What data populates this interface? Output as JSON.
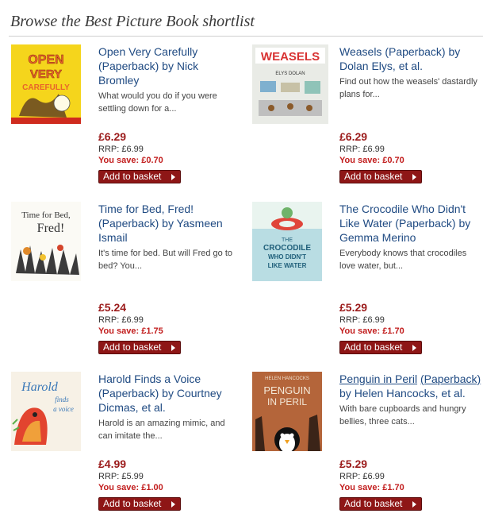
{
  "header": {
    "title": "Browse the Best Picture Book shortlist"
  },
  "labels": {
    "rrp_prefix": "RRP: ",
    "save_prefix": "You save: ",
    "add_button": "Add to basket"
  },
  "products": [
    {
      "title": "Open Very Carefully",
      "format": "(Paperback)",
      "by": "by",
      "author": "Nick Bromley",
      "blurb": "What would you do if you were settling down for a...",
      "price": "£6.29",
      "rrp": "£6.99",
      "save": "£0.70",
      "cover_text": [
        "OPEN",
        "VERY",
        "CAREFULLY"
      ]
    },
    {
      "title": "Weasels",
      "format": "(Paperback)",
      "by": "by",
      "author": "Dolan Elys, et al.",
      "blurb": "Find out how the weasels' dastardly plans for...",
      "price": "£6.29",
      "rrp": "£6.99",
      "save": "£0.70",
      "cover_text": [
        "WEASELS",
        "ELYS DOLAN"
      ]
    },
    {
      "title": "Time for Bed, Fred!",
      "format": "(Paperback)",
      "by": "by",
      "author": "Yasmeen Ismail",
      "blurb": "It's time for bed. But will Fred go to bed? You...",
      "price": "£5.24",
      "rrp": "£6.99",
      "save": "£1.75",
      "cover_text": [
        "Time for Bed,",
        "Fred!"
      ]
    },
    {
      "title": "The Crocodile Who Didn't Like Water",
      "format": "(Paperback)",
      "by": "by",
      "author": "Gemma Merino",
      "blurb": "Everybody knows that crocodiles love water, but...",
      "price": "£5.29",
      "rrp": "£6.99",
      "save": "£1.70",
      "cover_text": [
        "THE",
        "CROCODILE",
        "WHO DIDN'T",
        "LIKE WATER"
      ]
    },
    {
      "title": "Harold Finds a Voice",
      "format": "(Paperback)",
      "by": "by",
      "author": "Courtney Dicmas, et al.",
      "blurb": "Harold is an amazing mimic, and can imitate the...",
      "price": "£4.99",
      "rrp": "£5.99",
      "save": "£1.00",
      "cover_text": [
        "Harold",
        "finds",
        "a voice"
      ]
    },
    {
      "title": "Penguin in Peril",
      "format": "(Paperback)",
      "by": "by",
      "author": "Helen Hancocks, et al.",
      "blurb": "With bare cupboards and hungry bellies, three cats...",
      "price": "£5.29",
      "rrp": "£6.99",
      "save": "£1.70",
      "cover_text": [
        "HELEN HANCOCKS",
        "PENGUIN",
        "IN PERIL"
      ]
    }
  ]
}
